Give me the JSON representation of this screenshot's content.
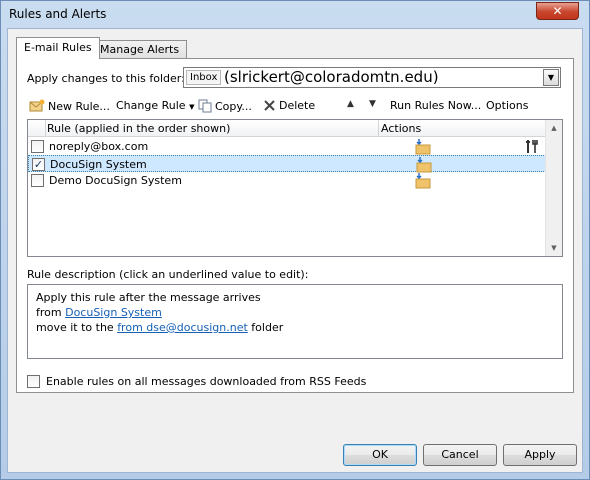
{
  "window": {
    "title": "Rules and Alerts",
    "close_label": "✕"
  },
  "tabs": [
    {
      "label": "E-mail Rules",
      "active": true
    },
    {
      "label": "Manage Alerts",
      "active": false
    }
  ],
  "folder": {
    "label": "Apply changes to this folder:",
    "inbox": "Inbox",
    "path": "(slrickert@coloradomtn.edu)"
  },
  "toolbar": {
    "new_rule": "New Rule...",
    "change_rule": "Change Rule",
    "copy": "Copy...",
    "delete": "Delete",
    "run_rules": "Run Rules Now...",
    "options": "Options"
  },
  "rules_list": {
    "col_rule": "Rule (applied in the order shown)",
    "col_actions": "Actions",
    "rows": [
      {
        "name": "noreply@box.com",
        "checked": false,
        "selected": false
      },
      {
        "name": "DocuSign System",
        "checked": true,
        "selected": true
      },
      {
        "name": "Demo DocuSign System",
        "checked": false,
        "selected": false
      }
    ]
  },
  "description": {
    "label": "Rule description (click an underlined value to edit):",
    "line1": "Apply this rule after the message arrives",
    "line2_prefix": "from",
    "line2_link": "DocuSign System",
    "line3_prefix": "move it to the",
    "line3_link": "from dse@docusign.net",
    "line3_suffix": "folder"
  },
  "rss": {
    "label": "Enable rules on all messages downloaded from RSS Feeds",
    "checked": false
  },
  "buttons": {
    "ok": "OK",
    "cancel": "Cancel",
    "apply": "Apply"
  },
  "colors": {
    "selection": "#cde8ff",
    "link": "#1560b5",
    "close": "#c7452c"
  }
}
